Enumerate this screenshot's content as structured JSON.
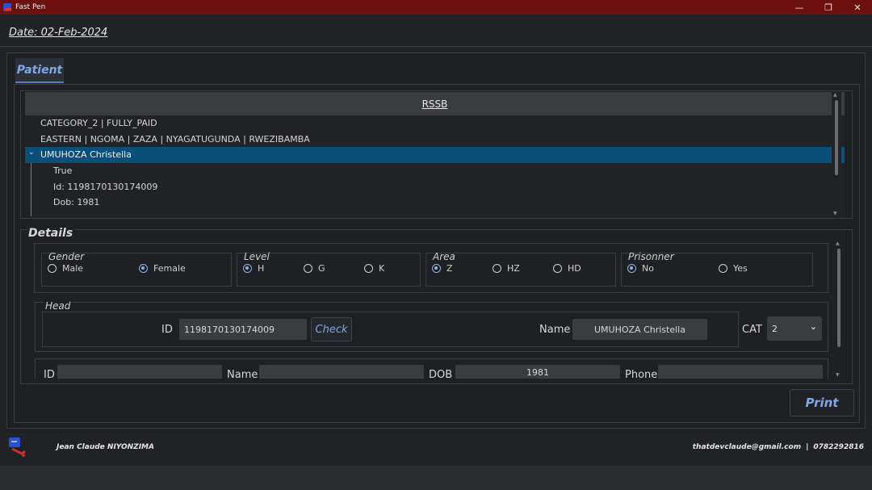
{
  "window": {
    "title": "Fast Pen",
    "minimize": "—",
    "restore": "❐",
    "close": "✕"
  },
  "date_label": "Date: 02-Feb-2024",
  "tab": {
    "label": "Patient"
  },
  "tree": {
    "header": "RSSB",
    "rows": [
      {
        "text": "CATEGORY_2 | FULLY_PAID",
        "level": 0
      },
      {
        "text": "EASTERN | NGOMA | ZAZA | NYAGATUGUNDA | RWEZIBAMBA",
        "level": 0
      },
      {
        "text": "UMUHOZA Christella",
        "level": 0,
        "selected": true
      },
      {
        "text": "True",
        "level": 1
      },
      {
        "text": "Id: 1198170130174009",
        "level": 1
      },
      {
        "text": "Dob: 1981",
        "level": 1
      }
    ]
  },
  "details": {
    "title": "Details",
    "gender": {
      "label": "Gender",
      "options": [
        "Male",
        "Female"
      ],
      "selected": "Female"
    },
    "level": {
      "label": "Level",
      "options": [
        "H",
        "G",
        "K"
      ],
      "selected": "H"
    },
    "area": {
      "label": "Area",
      "options": [
        "Z",
        "HZ",
        "HD"
      ],
      "selected": "Z"
    },
    "prisonner": {
      "label": "Prisonner",
      "options": [
        "No",
        "Yes"
      ],
      "selected": "No"
    },
    "head": {
      "title": "Head",
      "id_label": "ID",
      "id_value": "1198170130174009",
      "check_label": "Check",
      "name_label": "Name",
      "name_value": "UMUHOZA Christella",
      "cat_label": "CAT",
      "cat_value": "2"
    },
    "member_row": {
      "id_label": "ID",
      "name_label": "Name",
      "dob_label": "DOB",
      "dob_value": "1981",
      "phone_label": "Phone"
    }
  },
  "print_label": "Print",
  "footer": {
    "developer": "Jean Claude NIYONZIMA",
    "email": "thatdevclaude@gmail.com",
    "separator": "|",
    "phone": "0782292816"
  },
  "colors": {
    "titlebar": "#6e0f0f",
    "accent": "#7fa8e8",
    "selected_row": "#0a4f7a",
    "background": "#202226"
  }
}
